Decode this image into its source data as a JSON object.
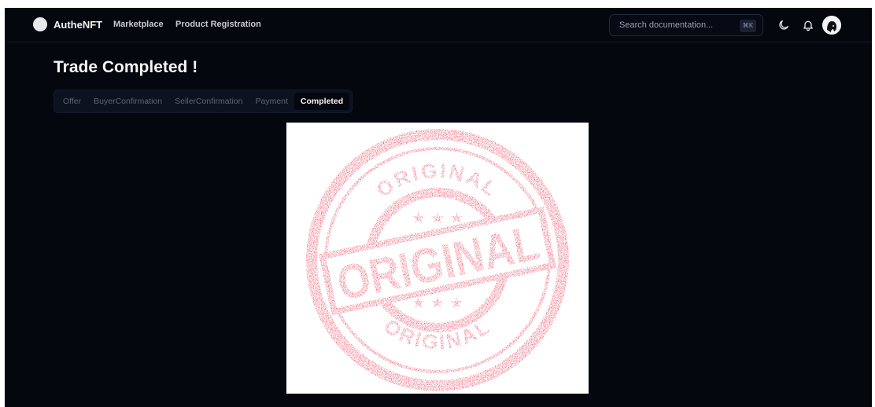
{
  "brand": {
    "name": "AutheNFT"
  },
  "nav": {
    "items": [
      {
        "label": "Marketplace"
      },
      {
        "label": "Product Registration"
      }
    ]
  },
  "search": {
    "placeholder": "Search documentation...",
    "shortcut": "⌘K"
  },
  "header_icons": [
    "moon-icon",
    "bell-icon",
    "avatar"
  ],
  "page": {
    "title": "Trade Completed !"
  },
  "steps": {
    "items": [
      {
        "label": "Offer"
      },
      {
        "label": "BuyerConfirmation"
      },
      {
        "label": "SellerConfirmation"
      },
      {
        "label": "Payment"
      },
      {
        "label": "Completed"
      }
    ],
    "active": "Completed"
  },
  "image": {
    "description": "red rubber stamp",
    "stamp_top": "ORIGINAL",
    "stamp_center": "ORIGINAL",
    "stamp_bottom": "ORIGINAL",
    "stamp_color": "#e31b3a"
  },
  "colors": {
    "background": "#05070f",
    "stamp": "#e31b3a"
  }
}
